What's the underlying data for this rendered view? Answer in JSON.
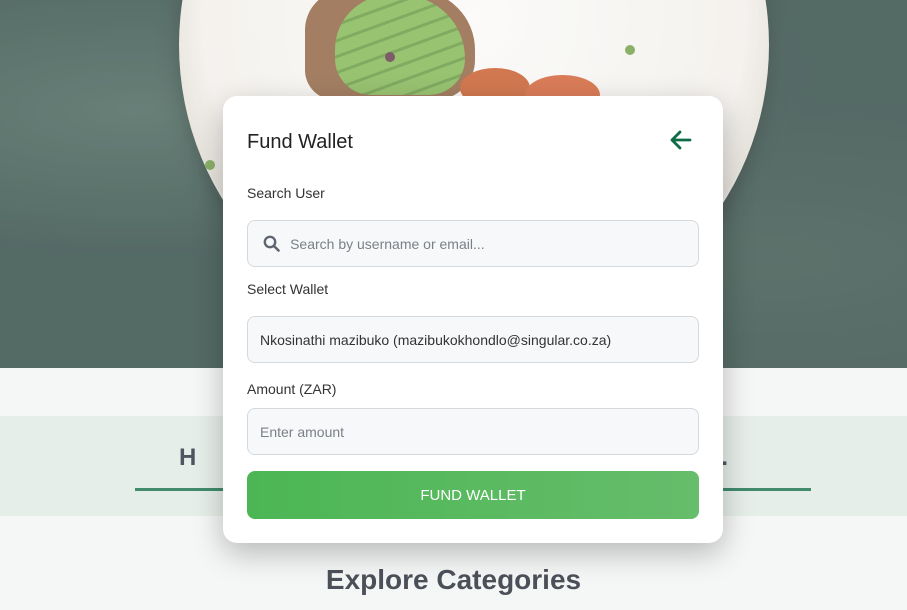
{
  "background": {
    "band_title": "H                                                                             y.",
    "explore_title": "Explore Categories"
  },
  "modal": {
    "title": "Fund Wallet",
    "back_icon": "arrow-left-icon",
    "search_user": {
      "label": "Search User",
      "placeholder": "Search by username or email...",
      "icon": "search-icon"
    },
    "select_wallet": {
      "label": "Select Wallet",
      "selected": "Nkosinathi mazibuko (mazibukokhondlo@singular.co.za)"
    },
    "amount": {
      "label": "Amount (ZAR)",
      "placeholder": "Enter amount"
    },
    "submit_label": "FUND WALLET"
  },
  "colors": {
    "accent": "#0d6b45",
    "button": "#55b85b"
  }
}
